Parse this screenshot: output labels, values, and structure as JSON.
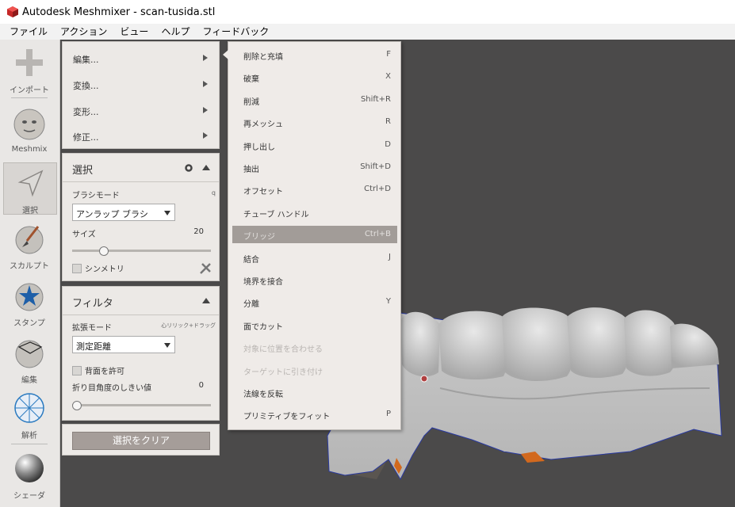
{
  "window": {
    "title": "Autodesk Meshmixer - scan-tusida.stl"
  },
  "menubar": [
    "ファイル",
    "アクション",
    "ビュー",
    "ヘルプ",
    "フィードバック"
  ],
  "toolbar": {
    "import": "インポート",
    "meshmix": "Meshmix",
    "select": "選択",
    "sculpt": "スカルプト",
    "stamp": "スタンプ",
    "edit": "編集",
    "analysis": "解析",
    "shader": "シェーダ"
  },
  "edit_panel": {
    "items": [
      "編集...",
      "変換...",
      "変形...",
      "修正..."
    ]
  },
  "select_panel": {
    "title": "選択",
    "brush_mode_label": "ブラシモード",
    "brush_mode_value": "アンラップ ブラシ",
    "size_label": "サイズ",
    "size_value": "20",
    "symmetry_label": "シンメトリ",
    "brush_mode_slider": 0.22
  },
  "filter_panel": {
    "title": "フィルタ",
    "expand_mode_label": "拡張モード",
    "expand_mode_hint": "心リリック+ドラッグ",
    "expand_mode_value": "測定距離",
    "backface_label": "背面を許可",
    "crease_label": "折り目角度のしきい値",
    "crease_value": "0",
    "crease_slider": 0.0
  },
  "clear_button": "選択をクリア",
  "edit_menu": {
    "items": [
      {
        "label": "削除と充填",
        "shortcut": "F",
        "state": "normal"
      },
      {
        "label": "破棄",
        "shortcut": "X",
        "state": "normal"
      },
      {
        "label": "削減",
        "shortcut": "Shift+R",
        "state": "normal"
      },
      {
        "label": "再メッシュ",
        "shortcut": "R",
        "state": "normal"
      },
      {
        "label": "押し出し",
        "shortcut": "D",
        "state": "normal"
      },
      {
        "label": "抽出",
        "shortcut": "Shift+D",
        "state": "normal"
      },
      {
        "label": "オフセット",
        "shortcut": "Ctrl+D",
        "state": "normal"
      },
      {
        "label": "チューブ ハンドル",
        "shortcut": "",
        "state": "normal"
      },
      {
        "label": "ブリッジ",
        "shortcut": "Ctrl+B",
        "state": "highlight"
      },
      {
        "label": "結合",
        "shortcut": "J",
        "state": "normal"
      },
      {
        "label": "境界を接合",
        "shortcut": "",
        "state": "normal"
      },
      {
        "label": "分離",
        "shortcut": "Y",
        "state": "normal"
      },
      {
        "label": "面でカット",
        "shortcut": "",
        "state": "normal"
      },
      {
        "label": "対象に位置を合わせる",
        "shortcut": "",
        "state": "disabled"
      },
      {
        "label": "ターゲットに引き付け",
        "shortcut": "",
        "state": "disabled"
      },
      {
        "label": "法線を反転",
        "shortcut": "",
        "state": "normal"
      },
      {
        "label": "プリミティブをフィット",
        "shortcut": "P",
        "state": "normal"
      }
    ]
  }
}
